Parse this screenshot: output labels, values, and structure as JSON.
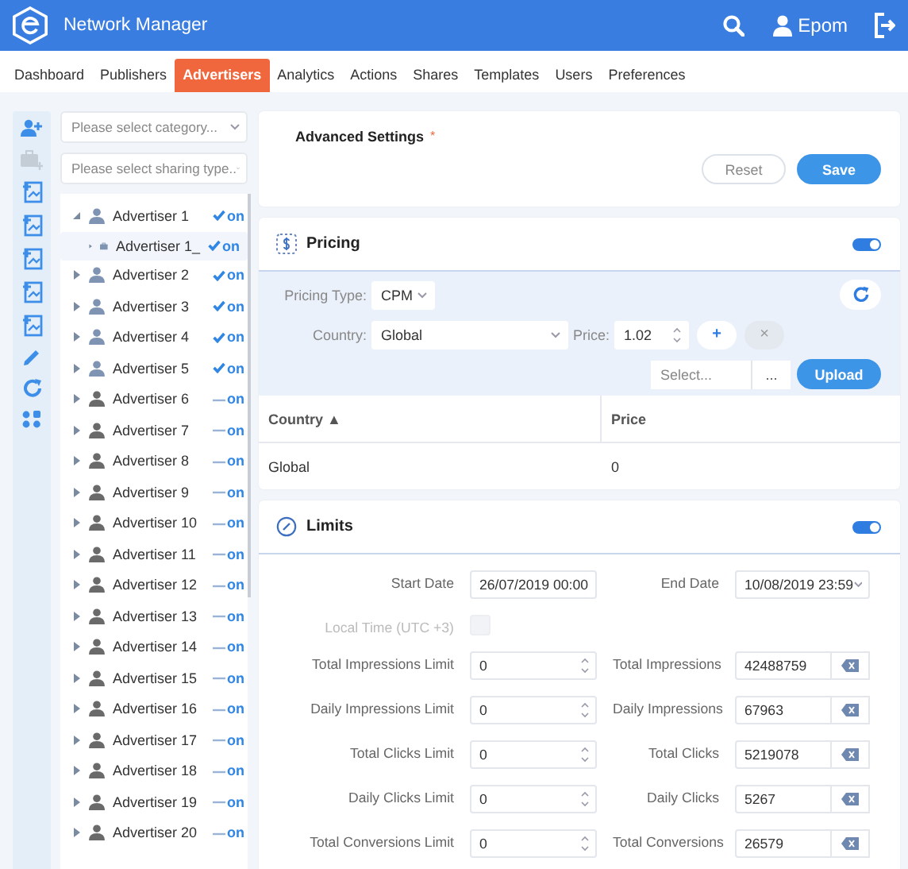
{
  "header": {
    "title": "Network Manager",
    "user": "Epom"
  },
  "tabs": [
    {
      "label": "Dashboard",
      "selected": false
    },
    {
      "label": "Publishers",
      "selected": false
    },
    {
      "label": "Advertisers",
      "selected": true
    },
    {
      "label": "Analytics",
      "selected": false
    },
    {
      "label": "Actions",
      "selected": false
    },
    {
      "label": "Shares",
      "selected": false
    },
    {
      "label": "Templates",
      "selected": false
    },
    {
      "label": "Users",
      "selected": false
    },
    {
      "label": "Preferences",
      "selected": false
    }
  ],
  "tools": [
    {
      "kind": "add-user",
      "disabled": false
    },
    {
      "kind": "add-case",
      "disabled": true
    },
    {
      "kind": "add-sheet",
      "disabled": false
    },
    {
      "kind": "add-sheet",
      "disabled": false
    },
    {
      "kind": "add-sheet",
      "disabled": false
    },
    {
      "kind": "add-sheet",
      "disabled": false
    },
    {
      "kind": "add-sheet",
      "disabled": false
    },
    {
      "kind": "edit",
      "disabled": false
    },
    {
      "kind": "refresh",
      "disabled": false
    },
    {
      "kind": "dots",
      "disabled": false
    }
  ],
  "filters": [
    {
      "placeholder": "Please select category..."
    },
    {
      "placeholder": "Please select sharing type.."
    }
  ],
  "tree": [
    {
      "name": "Advertiser 1",
      "kind": "advertiser",
      "active": true,
      "status": "on",
      "expanded": true,
      "selected": false,
      "children": [
        {
          "name": "Advertiser 1_",
          "kind": "campaign",
          "active": true,
          "status": "on",
          "expanded": false,
          "selected": true
        }
      ]
    },
    {
      "name": "Advertiser 2",
      "kind": "advertiser",
      "active": true,
      "status": "on",
      "expanded": false,
      "selected": false
    },
    {
      "name": "Advertiser 3",
      "kind": "advertiser",
      "active": true,
      "status": "on",
      "expanded": false,
      "selected": false
    },
    {
      "name": "Advertiser 4",
      "kind": "advertiser",
      "active": true,
      "status": "on",
      "expanded": false,
      "selected": false
    },
    {
      "name": "Advertiser 5",
      "kind": "advertiser",
      "active": true,
      "status": "on",
      "expanded": false,
      "selected": false
    },
    {
      "name": "Advertiser 6",
      "kind": "advertiser",
      "active": false,
      "status": "on",
      "expanded": false,
      "selected": false
    },
    {
      "name": "Advertiser 7",
      "kind": "advertiser",
      "active": false,
      "status": "on",
      "expanded": false,
      "selected": false
    },
    {
      "name": "Advertiser 8",
      "kind": "advertiser",
      "active": false,
      "status": "on",
      "expanded": false,
      "selected": false
    },
    {
      "name": "Advertiser 9",
      "kind": "advertiser",
      "active": false,
      "status": "on",
      "expanded": false,
      "selected": false
    },
    {
      "name": "Advertiser 10",
      "kind": "advertiser",
      "active": false,
      "status": "on",
      "expanded": false,
      "selected": false
    },
    {
      "name": "Advertiser 11",
      "kind": "advertiser",
      "active": false,
      "status": "on",
      "expanded": false,
      "selected": false
    },
    {
      "name": "Advertiser 12",
      "kind": "advertiser",
      "active": false,
      "status": "on",
      "expanded": false,
      "selected": false
    },
    {
      "name": "Advertiser 13",
      "kind": "advertiser",
      "active": false,
      "status": "on",
      "expanded": false,
      "selected": false
    },
    {
      "name": "Advertiser 14",
      "kind": "advertiser",
      "active": false,
      "status": "on",
      "expanded": false,
      "selected": false
    },
    {
      "name": "Advertiser 15",
      "kind": "advertiser",
      "active": false,
      "status": "on",
      "expanded": false,
      "selected": false
    },
    {
      "name": "Advertiser 16",
      "kind": "advertiser",
      "active": false,
      "status": "on",
      "expanded": false,
      "selected": false
    },
    {
      "name": "Advertiser 17",
      "kind": "advertiser",
      "active": false,
      "status": "on",
      "expanded": false,
      "selected": false
    },
    {
      "name": "Advertiser 18",
      "kind": "advertiser",
      "active": false,
      "status": "on",
      "expanded": false,
      "selected": false
    },
    {
      "name": "Advertiser 19",
      "kind": "advertiser",
      "active": false,
      "status": "on",
      "expanded": false,
      "selected": false
    },
    {
      "name": "Advertiser 20",
      "kind": "advertiser",
      "active": false,
      "status": "on",
      "expanded": false,
      "selected": false
    }
  ],
  "advanced": {
    "title": "Advanced Settings",
    "required_mark": "*",
    "buttons": [
      "Reset",
      "Save"
    ]
  },
  "pricing": {
    "title": "Pricing",
    "on": true,
    "pricing_type_label": "Pricing Type:",
    "pricing_type": "CPM",
    "country_label": "Country:",
    "country": "Global",
    "price_label": "Price:",
    "price": "1.02",
    "add": "+",
    "remove": "×",
    "file_placeholder": "Select...",
    "browse": "...",
    "upload": "Upload",
    "table": {
      "columns": [
        "Country ▲",
        "Price"
      ],
      "rows": [
        [
          "Global",
          "0"
        ]
      ]
    }
  },
  "limits": {
    "title": "Limits",
    "on": true,
    "start_label": "Start Date",
    "start": "26/07/2019 00:00",
    "end_label": "End Date",
    "end": "10/08/2019 23:59",
    "local_time_label": "Local Time (UTC +3)",
    "local_time": {
      "checked": false,
      "disabled": true
    },
    "rows": [
      {
        "limit_label": "Total Impressions Limit",
        "limit_value": "0",
        "stat_label": "Total Impressions",
        "stat_value": "42488759"
      },
      {
        "limit_label": "Daily Impressions Limit",
        "limit_value": "0",
        "stat_label": "Daily Impressions",
        "stat_value": "67963"
      },
      {
        "limit_label": "Total Clicks Limit",
        "limit_value": "0",
        "stat_label": "Total Clicks",
        "stat_value": "5219078"
      },
      {
        "limit_label": "Daily Clicks Limit",
        "limit_value": "0",
        "stat_label": "Daily Clicks",
        "stat_value": "5267"
      },
      {
        "limit_label": "Total Conversions Limit",
        "limit_value": "0",
        "stat_label": "Total Conversions",
        "stat_value": "26579"
      }
    ]
  }
}
